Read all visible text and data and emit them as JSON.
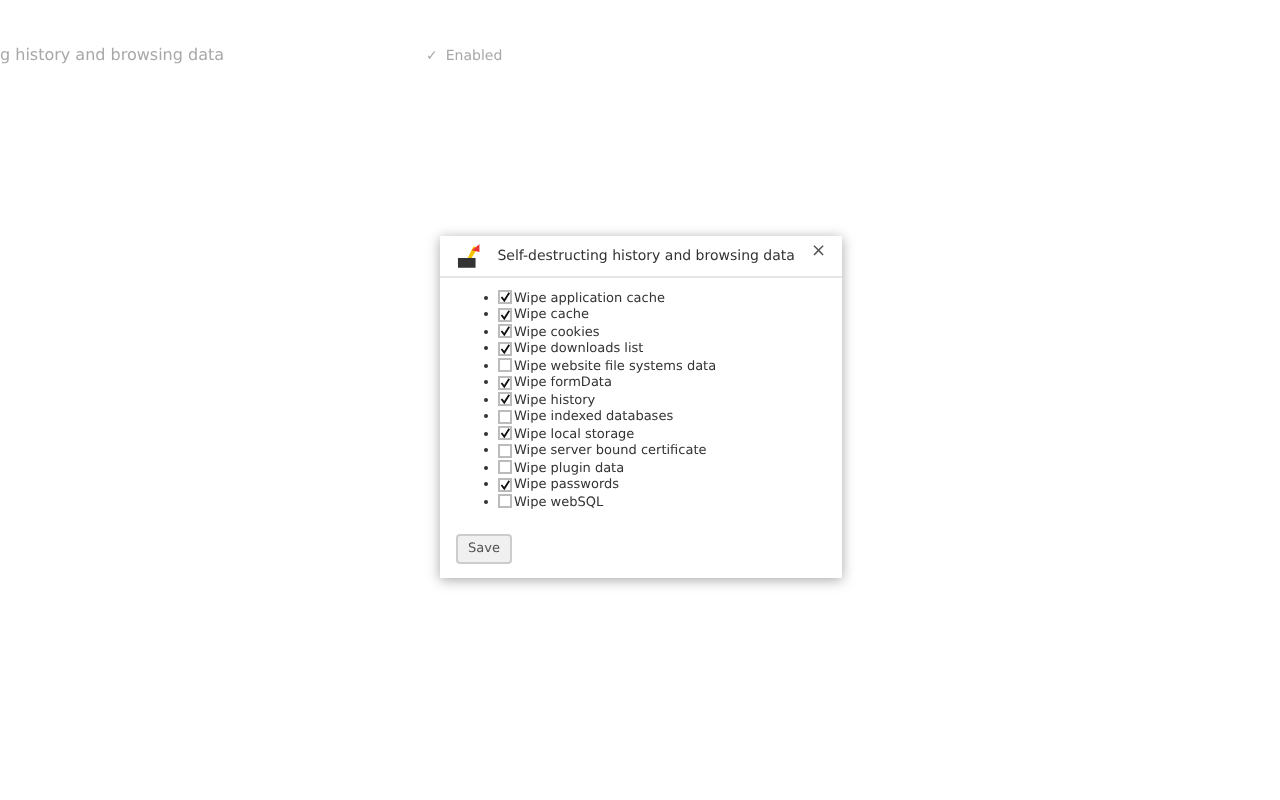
{
  "background": {
    "title": "g history and browsing data",
    "enabled_check": "✓",
    "enabled_label": "Enabled"
  },
  "dialog": {
    "title": "Self-destructing history and browsing data",
    "close": "×",
    "options": [
      {
        "label": "Wipe application cache",
        "checked": true
      },
      {
        "label": "Wipe cache",
        "checked": true
      },
      {
        "label": "Wipe cookies",
        "checked": true
      },
      {
        "label": "Wipe downloads list",
        "checked": true
      },
      {
        "label": "Wipe website file systems data",
        "checked": false
      },
      {
        "label": "Wipe formData",
        "checked": true
      },
      {
        "label": "Wipe history",
        "checked": true
      },
      {
        "label": "Wipe indexed databases",
        "checked": false
      },
      {
        "label": "Wipe local storage",
        "checked": true
      },
      {
        "label": "Wipe server bound certificate",
        "checked": false
      },
      {
        "label": "Wipe plugin data",
        "checked": false
      },
      {
        "label": "Wipe passwords",
        "checked": true
      },
      {
        "label": "Wipe webSQL",
        "checked": false
      }
    ],
    "save": "Save"
  }
}
